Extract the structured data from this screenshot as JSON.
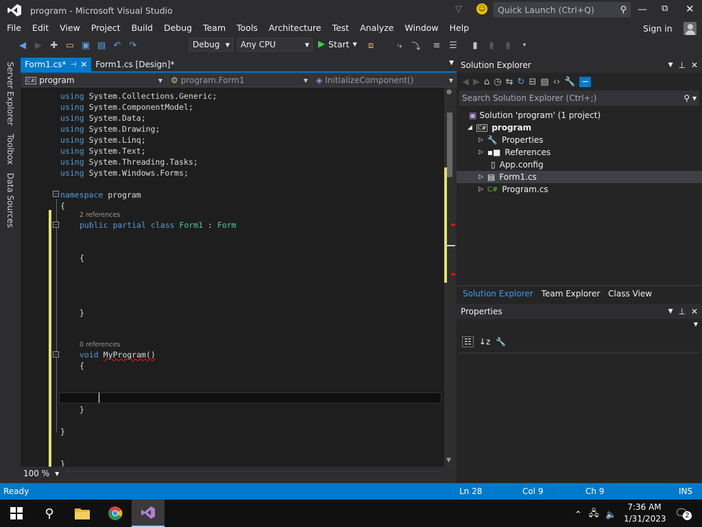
{
  "titlebar": {
    "title": "program - Microsoft Visual Studio",
    "quick_launch_placeholder": "Quick Launch (Ctrl+Q)"
  },
  "menu": {
    "items": [
      "File",
      "Edit",
      "View",
      "Project",
      "Build",
      "Debug",
      "Team",
      "Tools",
      "Architecture",
      "Test",
      "Analyze",
      "Window",
      "Help"
    ],
    "sign_in": "Sign in"
  },
  "toolbar": {
    "config": "Debug",
    "platform": "Any CPU",
    "start_label": "Start"
  },
  "left_strip": {
    "tabs": [
      "Server Explorer",
      "Toolbox",
      "Data Sources"
    ]
  },
  "tabs": [
    {
      "label": "Form1.cs*",
      "active": true
    },
    {
      "label": "Form1.cs [Design]*",
      "active": false
    }
  ],
  "nav": {
    "project": "program",
    "class": "program.Form1",
    "member": "InitializeComponent()"
  },
  "code": {
    "usings": [
      [
        "using",
        "System.Collections.Generic;"
      ],
      [
        "using",
        "System.ComponentModel;"
      ],
      [
        "using",
        "System.Data;"
      ],
      [
        "using",
        "System.Drawing;"
      ],
      [
        "using",
        "System.Linq;"
      ],
      [
        "using",
        "System.Text;"
      ],
      [
        "using",
        "System.Threading.Tasks;"
      ],
      [
        "using",
        "System.Windows.Forms;"
      ]
    ],
    "ns_kw": "namespace",
    "ns_name": "program",
    "open_brace": "{",
    "close_brace": "}",
    "refs_class": "2 references",
    "class_kw": "public partial class",
    "class_name": "Form1",
    "colon": ":",
    "class_base": "Form",
    "refs_method": "0 references",
    "method_kw": "void",
    "method_name": "MyProgram()"
  },
  "zoom": "100 %",
  "solution_explorer": {
    "title": "Solution Explorer",
    "search_placeholder": "Search Solution Explorer (Ctrl+;)",
    "solution": "Solution 'program' (1 project)",
    "project": "program",
    "items": [
      "Properties",
      "References",
      "App.config",
      "Form1.cs",
      "Program.cs"
    ],
    "bottom_tabs": [
      "Solution Explorer",
      "Team Explorer",
      "Class View"
    ]
  },
  "properties": {
    "title": "Properties"
  },
  "status": {
    "ready": "Ready",
    "ln": "Ln 28",
    "col": "Col 9",
    "ch": "Ch 9",
    "ins": "INS"
  },
  "taskbar": {
    "time": "7:36 AM",
    "date": "1/31/2023",
    "notifications": "2"
  }
}
